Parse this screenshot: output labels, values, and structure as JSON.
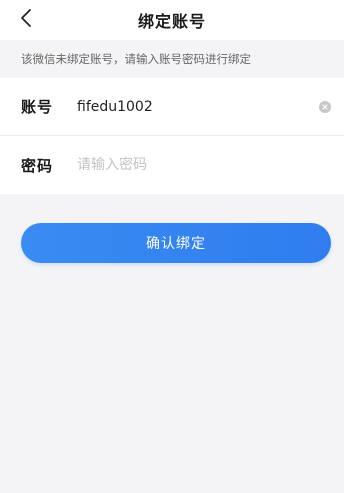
{
  "header": {
    "title": "绑定账号",
    "back_icon": "chevron-left-icon"
  },
  "notice": {
    "text": "该微信未绑定账号，请输入账号密码进行绑定"
  },
  "form": {
    "account": {
      "label": "账号",
      "value": "fifedu1002",
      "clear_icon": "clear-icon"
    },
    "password": {
      "label": "密码",
      "value": "",
      "placeholder": "请输入密码"
    }
  },
  "actions": {
    "confirm_label": "确认绑定"
  },
  "colors": {
    "accent": "#2f7def",
    "background": "#f4f4f6",
    "placeholder": "#c3c3c3"
  }
}
